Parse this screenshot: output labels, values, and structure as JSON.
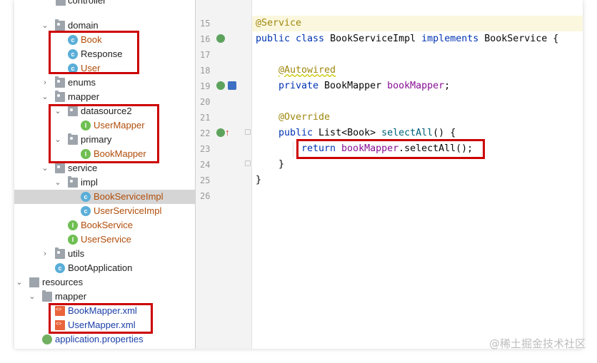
{
  "tree": {
    "cut_top": "controller",
    "domain": "domain",
    "book": "Book",
    "response": "Response",
    "user": "User",
    "enums": "enums",
    "mapper": "mapper",
    "datasource2": "datasource2",
    "user_mapper": "UserMapper",
    "primary": "primary",
    "book_mapper": "BookMapper",
    "service": "service",
    "impl": "impl",
    "book_service_impl": "BookServiceImpl",
    "user_service_impl": "UserServiceImpl",
    "book_service": "BookService",
    "user_service": "UserService",
    "utils": "utils",
    "boot_application": "BootApplication",
    "resources": "resources",
    "res_mapper": "mapper",
    "book_mapper_xml": "BookMapper.xml",
    "user_mapper_xml": "UserMapper.xml",
    "app_properties": "application.properties"
  },
  "gutter": {
    "lines": [
      "15",
      "16",
      "17",
      "18",
      "19",
      "20",
      "21",
      "22",
      "23",
      "24",
      "25",
      "26"
    ]
  },
  "code": {
    "l15_ann": "@Service",
    "l16_kw1": "public class ",
    "l16_name": "BookServiceImpl ",
    "l16_kw2": "implements ",
    "l16_rest": "BookService {",
    "l18_ann": "@Autowired",
    "l19_kw": "private ",
    "l19_type": "BookMapper ",
    "l19_field": "bookMapper",
    "l19_end": ";",
    "l21_ann": "@Override",
    "l22_kw": "public ",
    "l22_type": "List<Book> ",
    "l22_method": "selectAll",
    "l22_end": "() {",
    "l23_kw": "return ",
    "l23_field": "bookMapper",
    "l23_call": ".selectAll();",
    "l24": "}",
    "l25": "}"
  },
  "watermark": "@稀土掘金技术社区",
  "colors": {
    "highlight_box": "#cc0000",
    "class_icon": "#5aaed8",
    "interface_icon": "#6fbf52",
    "xml_icon": "#e9643b",
    "keyword": "#0033b3",
    "annotation": "#9e880d",
    "field": "#871094",
    "method": "#00627a"
  }
}
